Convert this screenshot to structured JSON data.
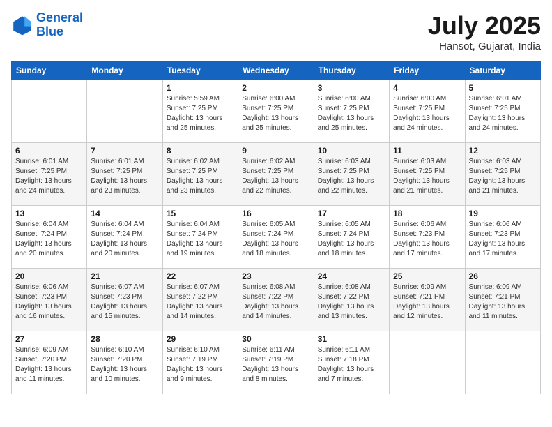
{
  "header": {
    "logo_line1": "General",
    "logo_line2": "Blue",
    "month_year": "July 2025",
    "location": "Hansot, Gujarat, India"
  },
  "columns": [
    "Sunday",
    "Monday",
    "Tuesday",
    "Wednesday",
    "Thursday",
    "Friday",
    "Saturday"
  ],
  "weeks": [
    [
      {
        "day": "",
        "sunrise": "",
        "sunset": "",
        "daylight": ""
      },
      {
        "day": "",
        "sunrise": "",
        "sunset": "",
        "daylight": ""
      },
      {
        "day": "1",
        "sunrise": "Sunrise: 5:59 AM",
        "sunset": "Sunset: 7:25 PM",
        "daylight": "Daylight: 13 hours and 25 minutes."
      },
      {
        "day": "2",
        "sunrise": "Sunrise: 6:00 AM",
        "sunset": "Sunset: 7:25 PM",
        "daylight": "Daylight: 13 hours and 25 minutes."
      },
      {
        "day": "3",
        "sunrise": "Sunrise: 6:00 AM",
        "sunset": "Sunset: 7:25 PM",
        "daylight": "Daylight: 13 hours and 25 minutes."
      },
      {
        "day": "4",
        "sunrise": "Sunrise: 6:00 AM",
        "sunset": "Sunset: 7:25 PM",
        "daylight": "Daylight: 13 hours and 24 minutes."
      },
      {
        "day": "5",
        "sunrise": "Sunrise: 6:01 AM",
        "sunset": "Sunset: 7:25 PM",
        "daylight": "Daylight: 13 hours and 24 minutes."
      }
    ],
    [
      {
        "day": "6",
        "sunrise": "Sunrise: 6:01 AM",
        "sunset": "Sunset: 7:25 PM",
        "daylight": "Daylight: 13 hours and 24 minutes."
      },
      {
        "day": "7",
        "sunrise": "Sunrise: 6:01 AM",
        "sunset": "Sunset: 7:25 PM",
        "daylight": "Daylight: 13 hours and 23 minutes."
      },
      {
        "day": "8",
        "sunrise": "Sunrise: 6:02 AM",
        "sunset": "Sunset: 7:25 PM",
        "daylight": "Daylight: 13 hours and 23 minutes."
      },
      {
        "day": "9",
        "sunrise": "Sunrise: 6:02 AM",
        "sunset": "Sunset: 7:25 PM",
        "daylight": "Daylight: 13 hours and 22 minutes."
      },
      {
        "day": "10",
        "sunrise": "Sunrise: 6:03 AM",
        "sunset": "Sunset: 7:25 PM",
        "daylight": "Daylight: 13 hours and 22 minutes."
      },
      {
        "day": "11",
        "sunrise": "Sunrise: 6:03 AM",
        "sunset": "Sunset: 7:25 PM",
        "daylight": "Daylight: 13 hours and 21 minutes."
      },
      {
        "day": "12",
        "sunrise": "Sunrise: 6:03 AM",
        "sunset": "Sunset: 7:25 PM",
        "daylight": "Daylight: 13 hours and 21 minutes."
      }
    ],
    [
      {
        "day": "13",
        "sunrise": "Sunrise: 6:04 AM",
        "sunset": "Sunset: 7:24 PM",
        "daylight": "Daylight: 13 hours and 20 minutes."
      },
      {
        "day": "14",
        "sunrise": "Sunrise: 6:04 AM",
        "sunset": "Sunset: 7:24 PM",
        "daylight": "Daylight: 13 hours and 20 minutes."
      },
      {
        "day": "15",
        "sunrise": "Sunrise: 6:04 AM",
        "sunset": "Sunset: 7:24 PM",
        "daylight": "Daylight: 13 hours and 19 minutes."
      },
      {
        "day": "16",
        "sunrise": "Sunrise: 6:05 AM",
        "sunset": "Sunset: 7:24 PM",
        "daylight": "Daylight: 13 hours and 18 minutes."
      },
      {
        "day": "17",
        "sunrise": "Sunrise: 6:05 AM",
        "sunset": "Sunset: 7:24 PM",
        "daylight": "Daylight: 13 hours and 18 minutes."
      },
      {
        "day": "18",
        "sunrise": "Sunrise: 6:06 AM",
        "sunset": "Sunset: 7:23 PM",
        "daylight": "Daylight: 13 hours and 17 minutes."
      },
      {
        "day": "19",
        "sunrise": "Sunrise: 6:06 AM",
        "sunset": "Sunset: 7:23 PM",
        "daylight": "Daylight: 13 hours and 17 minutes."
      }
    ],
    [
      {
        "day": "20",
        "sunrise": "Sunrise: 6:06 AM",
        "sunset": "Sunset: 7:23 PM",
        "daylight": "Daylight: 13 hours and 16 minutes."
      },
      {
        "day": "21",
        "sunrise": "Sunrise: 6:07 AM",
        "sunset": "Sunset: 7:23 PM",
        "daylight": "Daylight: 13 hours and 15 minutes."
      },
      {
        "day": "22",
        "sunrise": "Sunrise: 6:07 AM",
        "sunset": "Sunset: 7:22 PM",
        "daylight": "Daylight: 13 hours and 14 minutes."
      },
      {
        "day": "23",
        "sunrise": "Sunrise: 6:08 AM",
        "sunset": "Sunset: 7:22 PM",
        "daylight": "Daylight: 13 hours and 14 minutes."
      },
      {
        "day": "24",
        "sunrise": "Sunrise: 6:08 AM",
        "sunset": "Sunset: 7:22 PM",
        "daylight": "Daylight: 13 hours and 13 minutes."
      },
      {
        "day": "25",
        "sunrise": "Sunrise: 6:09 AM",
        "sunset": "Sunset: 7:21 PM",
        "daylight": "Daylight: 13 hours and 12 minutes."
      },
      {
        "day": "26",
        "sunrise": "Sunrise: 6:09 AM",
        "sunset": "Sunset: 7:21 PM",
        "daylight": "Daylight: 13 hours and 11 minutes."
      }
    ],
    [
      {
        "day": "27",
        "sunrise": "Sunrise: 6:09 AM",
        "sunset": "Sunset: 7:20 PM",
        "daylight": "Daylight: 13 hours and 11 minutes."
      },
      {
        "day": "28",
        "sunrise": "Sunrise: 6:10 AM",
        "sunset": "Sunset: 7:20 PM",
        "daylight": "Daylight: 13 hours and 10 minutes."
      },
      {
        "day": "29",
        "sunrise": "Sunrise: 6:10 AM",
        "sunset": "Sunset: 7:19 PM",
        "daylight": "Daylight: 13 hours and 9 minutes."
      },
      {
        "day": "30",
        "sunrise": "Sunrise: 6:11 AM",
        "sunset": "Sunset: 7:19 PM",
        "daylight": "Daylight: 13 hours and 8 minutes."
      },
      {
        "day": "31",
        "sunrise": "Sunrise: 6:11 AM",
        "sunset": "Sunset: 7:18 PM",
        "daylight": "Daylight: 13 hours and 7 minutes."
      },
      {
        "day": "",
        "sunrise": "",
        "sunset": "",
        "daylight": ""
      },
      {
        "day": "",
        "sunrise": "",
        "sunset": "",
        "daylight": ""
      }
    ]
  ]
}
